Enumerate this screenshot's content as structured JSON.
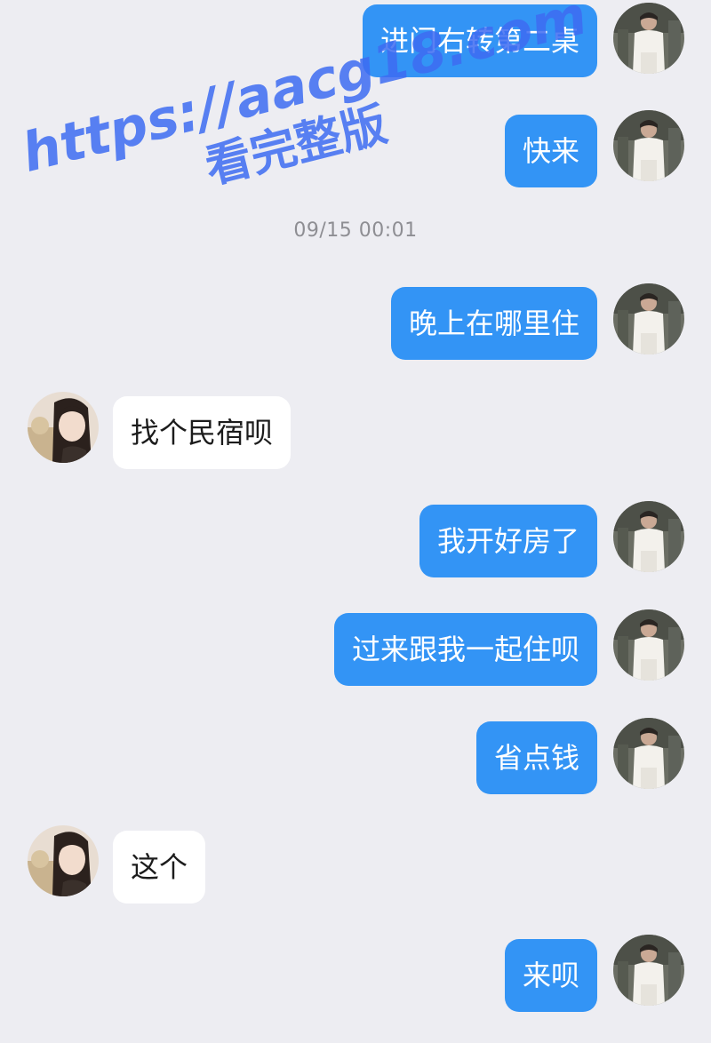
{
  "watermark": {
    "line1": "https://aacg18.com",
    "line2": "看完整版"
  },
  "timestamp": "09/15 00:01",
  "avatars": {
    "self": "self-avatar-icon",
    "other": "other-avatar-icon"
  },
  "messages": [
    {
      "sender": "self",
      "text": "进门右转第二桌"
    },
    {
      "sender": "self",
      "text": "快来"
    },
    {
      "sender": "self",
      "text": "晚上在哪里住"
    },
    {
      "sender": "other",
      "text": "找个民宿呗"
    },
    {
      "sender": "self",
      "text": "我开好房了"
    },
    {
      "sender": "self",
      "text": "过来跟我一起住呗"
    },
    {
      "sender": "self",
      "text": "省点钱"
    },
    {
      "sender": "other",
      "text": "这个"
    },
    {
      "sender": "self",
      "text": "来呗"
    }
  ],
  "colors": {
    "background": "#ededf2",
    "outgoing_bubble": "#3394f5",
    "incoming_bubble": "#ffffff",
    "watermark": "#3e6cf2"
  }
}
